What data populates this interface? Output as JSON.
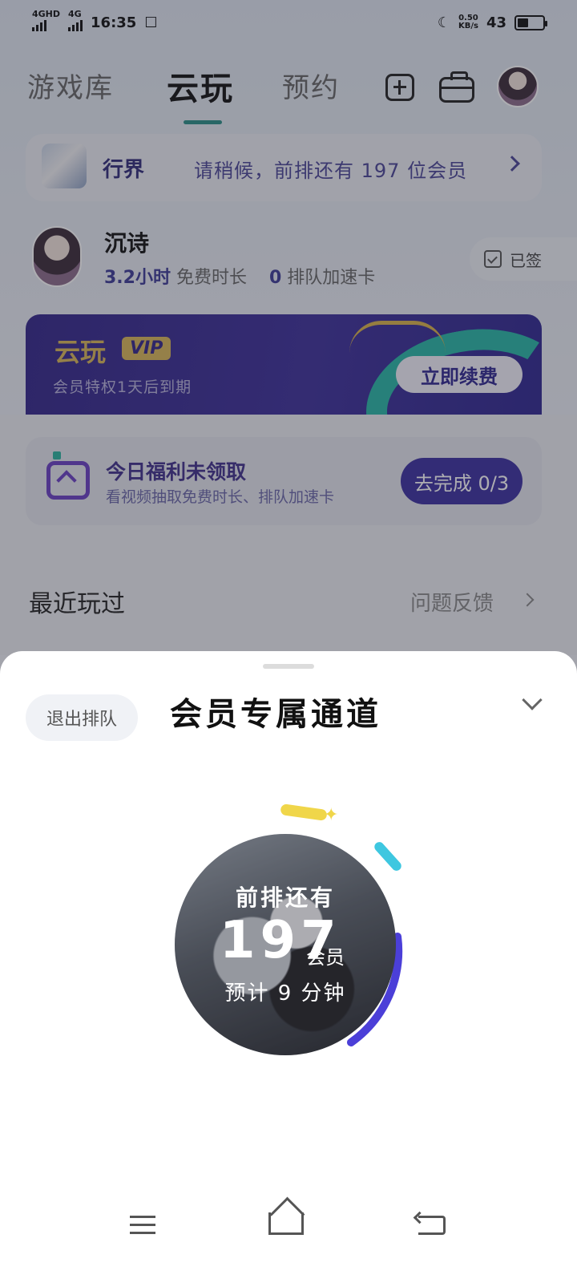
{
  "status_bar": {
    "network_1": "4GHD",
    "network_2": "4G",
    "time": "16:35",
    "net_speed_value": "0.50",
    "net_speed_unit": "KB/s",
    "battery_percent": "43",
    "battery_level": 0.43
  },
  "top_nav": {
    "tabs": [
      {
        "label": "游戏库"
      },
      {
        "label": "云玩"
      },
      {
        "label": "预约"
      }
    ],
    "active_tab": "云玩"
  },
  "queue_card": {
    "game_name": "行界",
    "message": "请稍候，前排还有 197 位会员"
  },
  "user": {
    "name": "沉诗",
    "free_hours": "3.2小时",
    "free_hours_label": "免费时长",
    "boost_cards": "0",
    "boost_cards_label": "排队加速卡",
    "signin_label": "已签"
  },
  "vip_card": {
    "title": "云玩",
    "badge": "VIP",
    "description": "会员特权1天后到期",
    "renew_label": "立即续费"
  },
  "bonus_card": {
    "title": "今日福利未领取",
    "subtitle": "看视频抽取免费时长、排队加速卡",
    "button_label": "去完成 0/3"
  },
  "recent": {
    "title": "最近玩过",
    "feedback_label": "问题反馈"
  },
  "sheet": {
    "exit_label": "退出排队",
    "title": "会员专属通道",
    "ring_label": "前排还有",
    "ring_count": "197",
    "ring_unit": "会员",
    "ring_eta": "预计 9 分钟"
  },
  "colors": {
    "accent": "#3b2fa0",
    "teal": "#27b6a6",
    "gold": "#d9b657",
    "progress": "#4b3fd8"
  }
}
